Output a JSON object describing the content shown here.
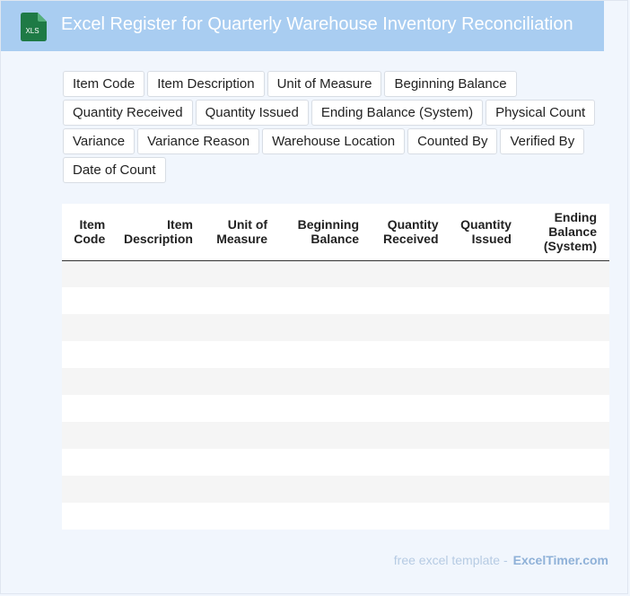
{
  "header": {
    "title": "Excel Register for Quarterly Warehouse Inventory Reconciliation",
    "icon": "xls-file-icon",
    "icon_label": "XLS",
    "icon_color": "#1e7a45",
    "bg_color": "#a9cdf1"
  },
  "chips": [
    "Item Code",
    "Item Description",
    "Unit of Measure",
    "Beginning Balance",
    "Quantity Received",
    "Quantity Issued",
    "Ending Balance (System)",
    "Physical Count",
    "Variance",
    "Variance Reason",
    "Warehouse Location",
    "Counted By",
    "Verified By",
    "Date of Count"
  ],
  "table": {
    "headers": [
      [
        "Item",
        "Code"
      ],
      [
        "Item",
        "Description"
      ],
      [
        "Unit of",
        "Measure"
      ],
      [
        "Beginning",
        "Balance"
      ],
      [
        "Quantity",
        "Received"
      ],
      [
        "Quantity",
        "Issued"
      ],
      [
        "Ending",
        "Balance",
        "(System)"
      ]
    ],
    "row_count": 10
  },
  "footer": {
    "text": "free excel template -",
    "brand": "ExcelTimer.com"
  }
}
